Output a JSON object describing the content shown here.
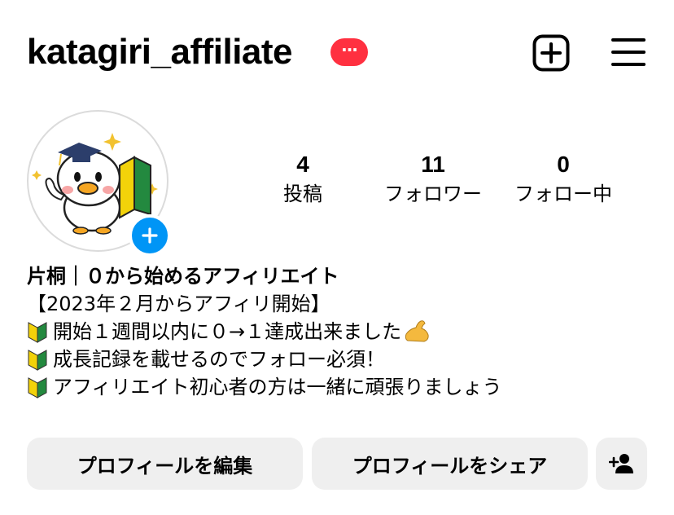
{
  "header": {
    "username": "katagiri_affiliate",
    "badge_text": "···",
    "badge_color": "#ff3040",
    "create_icon": "plus-square-icon",
    "menu_icon": "hamburger-menu-icon"
  },
  "profile": {
    "avatar_icon": "mascot-bird-avatar",
    "add_story_icon": "plus-icon",
    "stats": [
      {
        "value": "4",
        "label": "投稿"
      },
      {
        "value": "11",
        "label": "フォロワー"
      },
      {
        "value": "0",
        "label": "フォロー中"
      }
    ]
  },
  "bio": {
    "name": "片桐｜０から始めるアフィリエイト",
    "lines": [
      {
        "text": "【2023年２月からアフィリ開始】",
        "leading_icon": ""
      },
      {
        "text": "開始１週間以内に０→１達成出来ました",
        "leading_icon": "beginner-mark-icon",
        "trailing_icon": "flexed-biceps-icon"
      },
      {
        "text": "成長記録を載せるのでフォロー必須！",
        "leading_icon": "beginner-mark-icon"
      },
      {
        "text": "アフィリエイト初心者の方は一緒に頑張りましょう",
        "leading_icon": "beginner-mark-icon"
      }
    ]
  },
  "actions": {
    "edit_label": "プロフィールを編集",
    "share_label": "プロフィールをシェア",
    "discover_icon": "add-person-icon"
  },
  "colors": {
    "accent": "#0095f6",
    "button_bg": "#efefef",
    "badge": "#ff3040"
  }
}
